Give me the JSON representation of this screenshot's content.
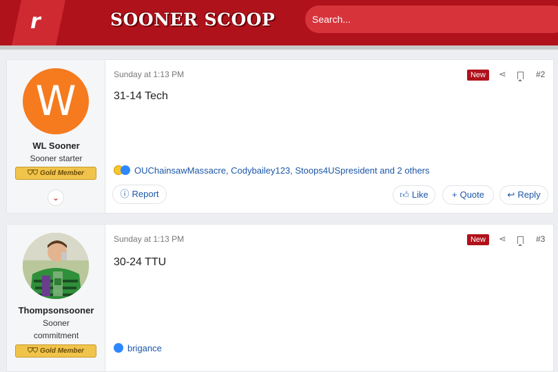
{
  "header": {
    "logo_letter": "r",
    "brand": "SOONER SCOOP",
    "search_placeholder": "Search..."
  },
  "posts": [
    {
      "author": "WL Sooner",
      "avatar_letter": "W",
      "user_title": "Sooner starter",
      "badge": "Gold Member",
      "date": "Sunday at 1:13 PM",
      "new_label": "New",
      "post_number": "#2",
      "content": "31-14 Tech",
      "reactions": "OUChainsawMassacre, Codybailey123, Stoops4USpresident and 2 others",
      "actions": {
        "report": "Report",
        "like": "Like",
        "quote": "Quote",
        "reply": "Reply"
      }
    },
    {
      "author": "Thompsonsooner",
      "user_title_line1": "Sooner",
      "user_title_line2": "commitment",
      "badge": "Gold Member",
      "date": "Sunday at 1:13 PM",
      "new_label": "New",
      "post_number": "#3",
      "content": "30-24 TTU",
      "reactions": "brigance"
    }
  ],
  "colors": {
    "brand_red": "#b0121b",
    "link_blue": "#1b56a7",
    "gold": "#f0c44a"
  }
}
